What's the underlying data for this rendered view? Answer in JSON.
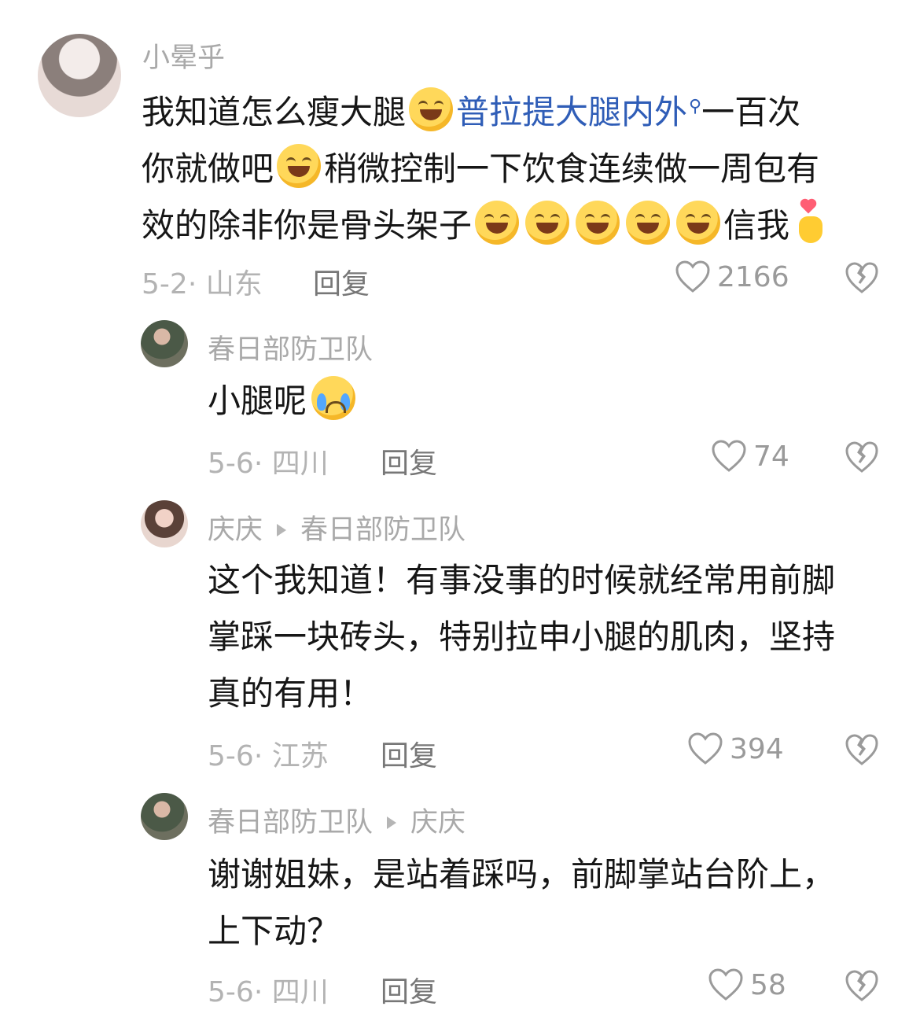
{
  "comments": [
    {
      "user": "小晕乎",
      "text_parts": [
        "我知道怎么瘦大腿",
        "普拉提大腿内外",
        "一百次",
        "你就做吧",
        "稍微控制一下饮食连续做一周包有",
        "效的除非你是骨头架子",
        "信我"
      ],
      "date": "5-2",
      "location": "山东",
      "reply_label": "回复",
      "likes": "2166"
    },
    {
      "user": "春日部防卫队",
      "text": "小腿呢",
      "date": "5-6",
      "location": "四川",
      "reply_label": "回复",
      "likes": "74"
    },
    {
      "user": "庆庆",
      "reply_to": "春日部防卫队",
      "lines": [
        "这个我知道！有事没事的时候就经常用前脚",
        "掌踩一块砖头，特别拉申小腿的肌肉，坚持",
        "真的有用！"
      ],
      "date": "5-6",
      "location": "江苏",
      "reply_label": "回复",
      "likes": "394"
    },
    {
      "user": "春日部防卫队",
      "reply_to": "庆庆",
      "lines": [
        "谢谢姐妹，是站着踩吗，前脚掌站台阶上，",
        "上下动？"
      ],
      "date": "5-6",
      "location": "四川",
      "reply_label": "回复",
      "likes": "58"
    }
  ],
  "colors": {
    "primary_text": "#161616",
    "muted_text": "#a9a9a9",
    "link_blue": "#2f5db7"
  }
}
